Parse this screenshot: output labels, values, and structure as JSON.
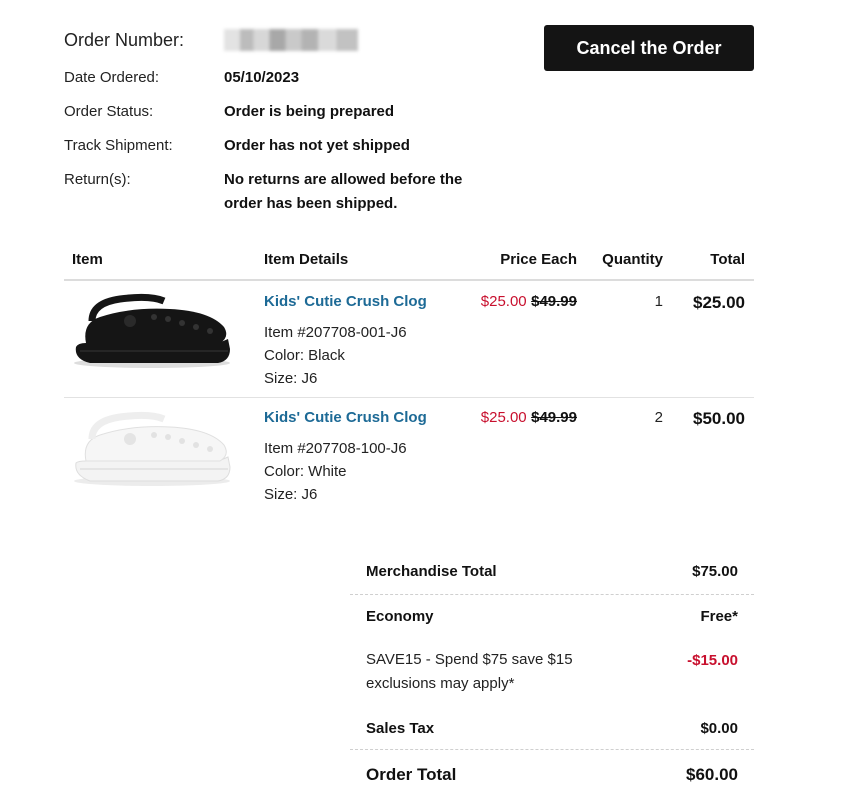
{
  "order_info": {
    "order_number_label": "Order Number:",
    "date_label": "Date Ordered:",
    "date_value": "05/10/2023",
    "status_label": "Order Status:",
    "status_value": "Order is being prepared",
    "track_label": "Track Shipment:",
    "track_value": "Order has not yet shipped",
    "returns_label": "Return(s):",
    "returns_value_line1": "No returns are allowed before the",
    "returns_value_line2": "order has been shipped."
  },
  "cancel_button_label": "Cancel the Order",
  "table": {
    "headers": [
      "Item",
      "Item Details",
      "Price Each",
      "Quantity",
      "Total"
    ],
    "rows": [
      {
        "name": "Kids' Cutie Crush Clog",
        "item_no": "Item #207708-001-J6",
        "color": "Color: Black",
        "size": "Size: J6",
        "sale_price": "$25.00",
        "orig_price": "$49.99",
        "qty": "1",
        "total": "$25.00",
        "shoe_color": "#151515"
      },
      {
        "name": "Kids' Cutie Crush Clog",
        "item_no": "Item #207708-100-J6",
        "color": "Color: White",
        "size": "Size: J6",
        "sale_price": "$25.00",
        "orig_price": "$49.99",
        "qty": "2",
        "total": "$50.00",
        "shoe_color": "#f4f4f4"
      }
    ]
  },
  "summary": {
    "merch_label": "Merchandise Total",
    "merch_value": "$75.00",
    "ship_label": "Economy",
    "ship_value": "Free*",
    "promo_line1": "SAVE15 -  Spend $75 save $15",
    "promo_line2": "exclusions may apply*",
    "promo_value": "-$15.00",
    "tax_label": "Sales Tax",
    "tax_value": "$0.00",
    "total_label": "Order Total",
    "total_value": "$60.00"
  },
  "colors": {
    "link": "#1d6a96",
    "sale": "#c8102e",
    "button": "#141414"
  }
}
